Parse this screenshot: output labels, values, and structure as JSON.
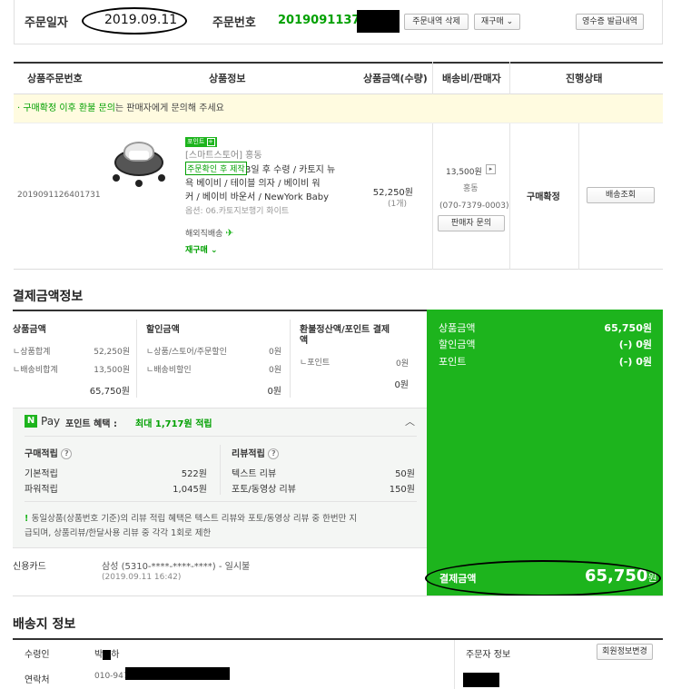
{
  "order": {
    "date_label": "주문일자",
    "date": "2019.09.11",
    "number_label": "주문번호",
    "number": "20190911378",
    "buttons": {
      "delete": "주문내역 삭제",
      "reorder": "재구매 ⌄",
      "receipt": "영수증 발급내역"
    }
  },
  "table": {
    "headers": [
      "상품주문번호",
      "상품정보",
      "상품금액(수량)",
      "배송비/판매자",
      "진행상태"
    ],
    "notice_green": "· 구매확정 이후 환불 문의",
    "notice_rest": "는 판매자에게 문의해 주세요",
    "row": {
      "product_order_no": "2019091126401731",
      "point_badge": "포인트",
      "store": "[스마트스토어] 홍동",
      "made_to_order": "주문확인 후 제작",
      "title_line1": " 3일 후 수령 / 카토지 뉴",
      "title_line2": "욕 베이비 / 테이블 의자 / 베이비 워",
      "title_line3": "커 / 베이비 바운서 / NewYork Baby",
      "option": "옵션: 06.카토지보행기 화이트",
      "overseas": "해외직배송",
      "reorder": "재구매 ⌄",
      "price": "52,250원",
      "qty": "(1개)",
      "shipping_fee": "13,500원",
      "seller": "홍동",
      "seller_phone": "(070-7379-0003)",
      "seller_inquiry": "판매자 문의",
      "status": "구매확정",
      "track_button": "배송조회"
    }
  },
  "payment": {
    "title": "결제금액정보",
    "product_amount": {
      "label": "상품금액",
      "items": [
        {
          "label": "ㄴ상품합계",
          "value": "52,250원"
        },
        {
          "label": "ㄴ배송비합계",
          "value": "13,500원"
        }
      ],
      "total": "65,750원"
    },
    "discount": {
      "label": "할인금액",
      "items": [
        {
          "label": "ㄴ상품/스토어/주문할인",
          "value": "0원"
        },
        {
          "label": "ㄴ배송비할인",
          "value": "0원"
        }
      ],
      "total": "0원"
    },
    "refund": {
      "label_line1": "환불정산액/포인트 결제",
      "label_line2": "액",
      "items": [
        {
          "label": "ㄴ포인트",
          "value": "0원"
        }
      ],
      "total": "0원"
    },
    "summary": [
      {
        "label": "상품금액",
        "value": "65,750원"
      },
      {
        "label": "할인금액",
        "value": "(-) 0원"
      },
      {
        "label": "포인트",
        "value": "(-) 0원"
      }
    ],
    "final_label": "결제금액",
    "final_value": "65,750",
    "final_unit": "원",
    "npay": {
      "logo": "N",
      "pay": "Pay",
      "benefit_label": "포인트 혜택 :",
      "benefit_value": "최대 1,717원 적립",
      "purchase_title": "구매적립",
      "purchase": [
        {
          "label": "기본적립",
          "value": "522원"
        },
        {
          "label": "파워적립",
          "value": "1,045원"
        }
      ],
      "review_title": "리뷰적립",
      "review": [
        {
          "label": "텍스트 리뷰",
          "value": "50원"
        },
        {
          "label": "포토/동영상 리뷰",
          "value": "150원"
        }
      ],
      "note_line1": "동일상품(상품번호 기준)의 리뷰 적립 혜택은 텍스트 리뷰와 포토/동영상 리뷰 중 한번만 지",
      "note_line2": "급되며, 상품리뷰/한달사용 리뷰 중 각각 1회로 제한"
    },
    "card": {
      "label": "신용카드",
      "value": "삼성 (5310-****-****-****) - 일시불",
      "datetime": "(2019.09.11 16:42)"
    }
  },
  "shipping": {
    "title": "배송지 정보",
    "receiver_label": "수령인",
    "receiver": "박",
    "receiver_suffix": "하",
    "contact_label": "연락처",
    "contact": "010-947",
    "orderer_label": "주문자 정보",
    "member_button": "회원정보변경"
  }
}
